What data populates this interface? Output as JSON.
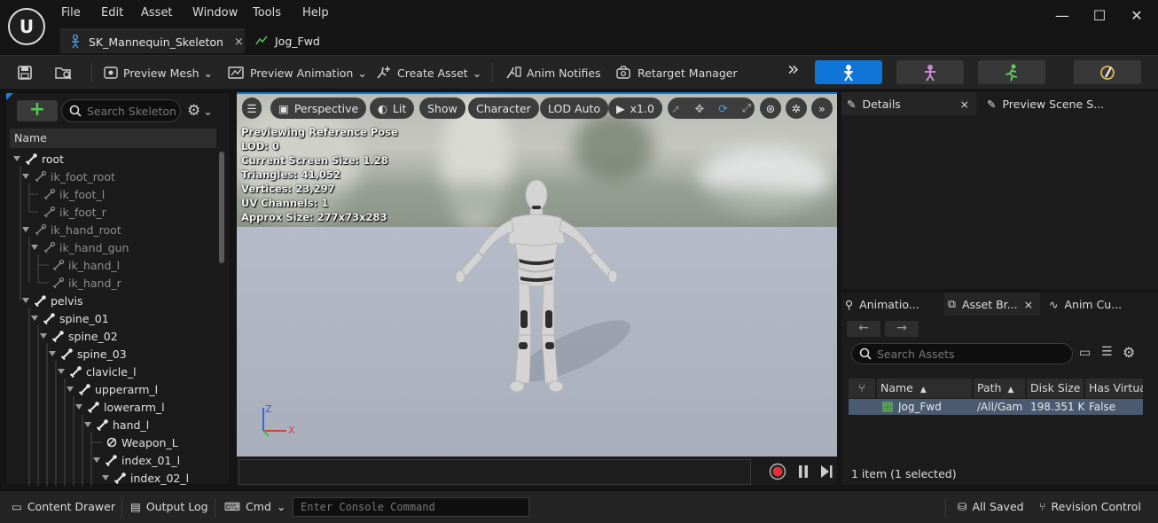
{
  "menu": [
    "File",
    "Edit",
    "Asset",
    "Window",
    "Tools",
    "Help"
  ],
  "tabs": [
    {
      "label": "SK_Mannequin_Skeleton",
      "close": "×"
    },
    {
      "label": "Jog_Fwd"
    }
  ],
  "window_controls": {
    "minimize": "—",
    "maximize": "☐",
    "close": "✕"
  },
  "toolbar": {
    "preview_mesh": "Preview Mesh",
    "preview_animation": "Preview Animation",
    "create_asset": "Create Asset",
    "anim_notifies": "Anim Notifies",
    "retarget_manager": "Retarget Manager",
    "overflow": "»"
  },
  "skeleton_tree": {
    "search_placeholder": "Search Skeleton",
    "column_header": "Name",
    "bones": [
      {
        "name": "root",
        "dim": false
      },
      {
        "name": "ik_foot_root",
        "dim": true
      },
      {
        "name": "ik_foot_l",
        "dim": true
      },
      {
        "name": "ik_foot_r",
        "dim": true
      },
      {
        "name": "ik_hand_root",
        "dim": true
      },
      {
        "name": "ik_hand_gun",
        "dim": true
      },
      {
        "name": "ik_hand_l",
        "dim": true
      },
      {
        "name": "ik_hand_r",
        "dim": true
      },
      {
        "name": "pelvis",
        "dim": false
      },
      {
        "name": "spine_01",
        "dim": false
      },
      {
        "name": "spine_02",
        "dim": false
      },
      {
        "name": "spine_03",
        "dim": false
      },
      {
        "name": "clavicle_l",
        "dim": false
      },
      {
        "name": "upperarm_l",
        "dim": false
      },
      {
        "name": "lowerarm_l",
        "dim": false
      },
      {
        "name": "hand_l",
        "dim": false
      },
      {
        "name": "Weapon_L",
        "dim": false
      },
      {
        "name": "index_01_l",
        "dim": false
      },
      {
        "name": "index_02_l",
        "dim": false
      }
    ]
  },
  "viewport": {
    "perspective": "Perspective",
    "lit": "Lit",
    "show": "Show",
    "character": "Character",
    "lod": "LOD Auto",
    "speed": "x1.0",
    "info": [
      "Previewing Reference Pose",
      "LOD: 0",
      "Current Screen Size: 1.28",
      "Triangles: 41,052",
      "Vertices: 23,297",
      "UV Channels: 1",
      "Approx Size: 277x73x283"
    ],
    "axis_z": "Z",
    "axis_x": "X"
  },
  "details_panel": {
    "tab_details": "Details",
    "tab_details_close": "×",
    "tab_preview_scene": "Preview Scene S..."
  },
  "asset_panel": {
    "tab_animation": "Animatio...",
    "tab_asset_browser": "Asset Br...",
    "tab_asset_browser_close": "×",
    "tab_anim_curves": "Anim Cu...",
    "search_placeholder": "Search Assets",
    "columns": [
      "Name",
      "Path",
      "Disk Size",
      "Has Virtua"
    ],
    "sort_indicator": "▲",
    "rows": [
      {
        "name": "Jog_Fwd",
        "path": "/All/Gam",
        "disk_size": "198.351 K",
        "has_virtual": "False"
      }
    ],
    "footer": "1 item (1 selected)"
  },
  "statusbar": {
    "content_drawer": "Content Drawer",
    "output_log": "Output Log",
    "cmd": "Cmd",
    "console_placeholder": "Enter Console Command",
    "all_saved": "All Saved",
    "revision_control": "Revision Control"
  },
  "colors": {
    "accent": "#0f75d7",
    "selection": "#4a5a71",
    "add_green": "#4ec94e",
    "record_red": "#e0303a"
  }
}
